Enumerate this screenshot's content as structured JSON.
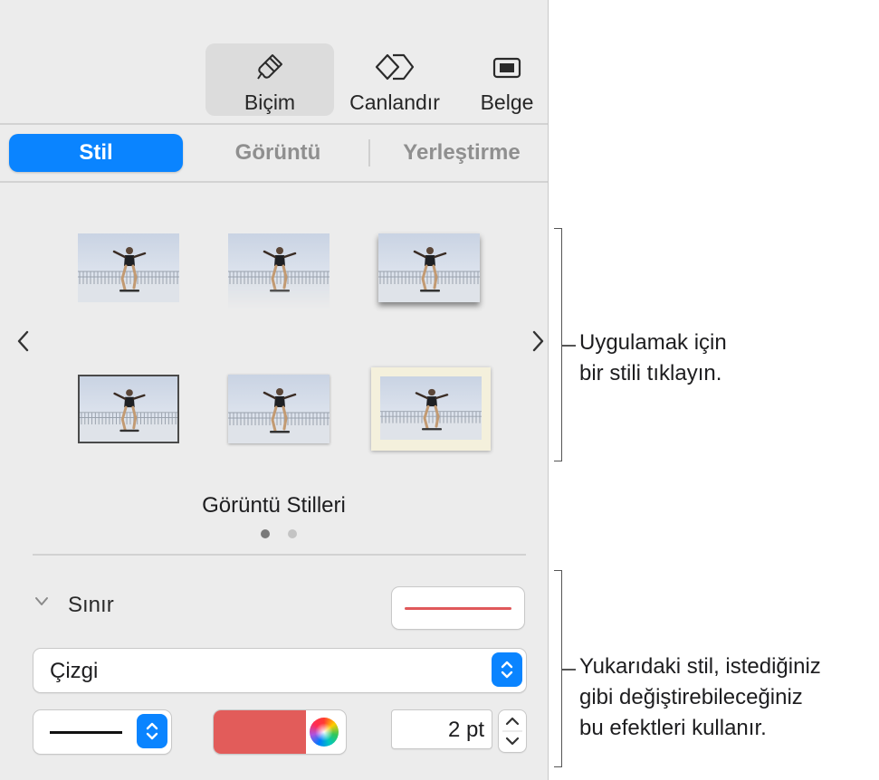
{
  "toolbar": {
    "items": [
      {
        "label": "Biçim",
        "icon": "paintbrush-icon",
        "active": true
      },
      {
        "label": "Canlandır",
        "icon": "diamond-icon",
        "active": false
      },
      {
        "label": "Belge",
        "icon": "document-icon",
        "active": false
      }
    ]
  },
  "tabs": {
    "items": [
      {
        "label": "Stil",
        "active": true
      },
      {
        "label": "Görüntü",
        "active": false
      },
      {
        "label": "Yerleştirme",
        "active": false
      }
    ]
  },
  "styles": {
    "title": "Görüntü Stilleri",
    "page_count": 2,
    "current_page": 1
  },
  "border": {
    "section_label": "Sınır",
    "line_type": "Çizgi",
    "width_value": "2 pt",
    "color": "#e25c5a",
    "swatch_line_color": "#e0585a"
  },
  "callouts": {
    "top": "Uygulamak için\nbir stili tıklayın.",
    "bottom": "Yukarıdaki stil, istediğiniz\ngibi değiştirebileceğiniz\nbu efektleri kullanır."
  },
  "colors": {
    "accent": "#0a84ff",
    "panel_bg": "#ececec"
  }
}
